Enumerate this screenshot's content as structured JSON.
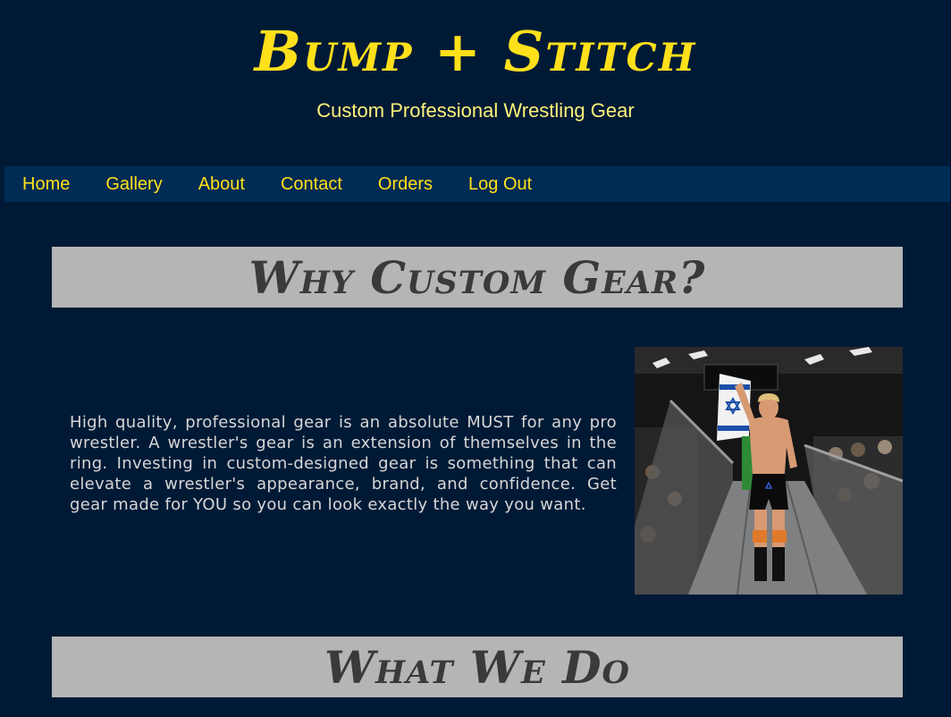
{
  "header": {
    "title": "Bump + Stitch",
    "tagline": "Custom Professional Wrestling Gear"
  },
  "nav": {
    "items": [
      {
        "label": "Home"
      },
      {
        "label": "Gallery"
      },
      {
        "label": "About"
      },
      {
        "label": "Contact"
      },
      {
        "label": "Orders"
      },
      {
        "label": "Log Out"
      }
    ]
  },
  "sections": {
    "why": {
      "heading": "Why Custom Gear?",
      "body": "High quality, professional gear is an absolute MUST for any pro wrestler. A wrestler's gear is an extension of themselves in the ring. Investing in custom-designed gear is something that can elevate a wrestler's appearance, brand, and confidence. Get gear made for YOU so you can look exactly the way you want."
    },
    "what": {
      "heading": "What We Do"
    }
  },
  "colors": {
    "background": "#001a36",
    "nav_background": "#002b54",
    "title_yellow": "#ffe01b",
    "banner_gray": "#b5b5b5",
    "banner_text": "#3a3a3a"
  },
  "images": {
    "hero_photo": "wrestler-entrance-photo"
  }
}
